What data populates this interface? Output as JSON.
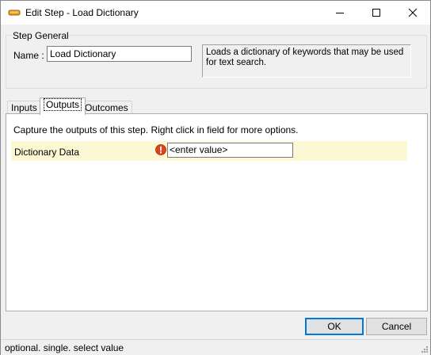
{
  "window": {
    "title": "Edit Step - Load Dictionary"
  },
  "step_general": {
    "group_title": "Step General",
    "name_label": "Name :",
    "name_value": "Load Dictionary",
    "description": "Loads a dictionary of keywords that may be used for text search."
  },
  "tabs": [
    {
      "label": "Inputs",
      "selected": false
    },
    {
      "label": "Outputs",
      "selected": true
    },
    {
      "label": "Outcomes",
      "selected": false
    }
  ],
  "outputs_panel": {
    "instructions": "Capture the outputs of this step.  Right click in field for more options.",
    "rows": [
      {
        "label": "Dictionary Data",
        "value": "<enter value>",
        "status_icon": "error-exclamation-icon"
      }
    ]
  },
  "buttons": {
    "ok": "OK",
    "cancel": "Cancel"
  },
  "status_bar": {
    "text": "optional. single. select value"
  },
  "colors": {
    "row_highlight": "#fcf8d4",
    "focus_border": "#0078d7",
    "error_icon": "#e0441c"
  }
}
